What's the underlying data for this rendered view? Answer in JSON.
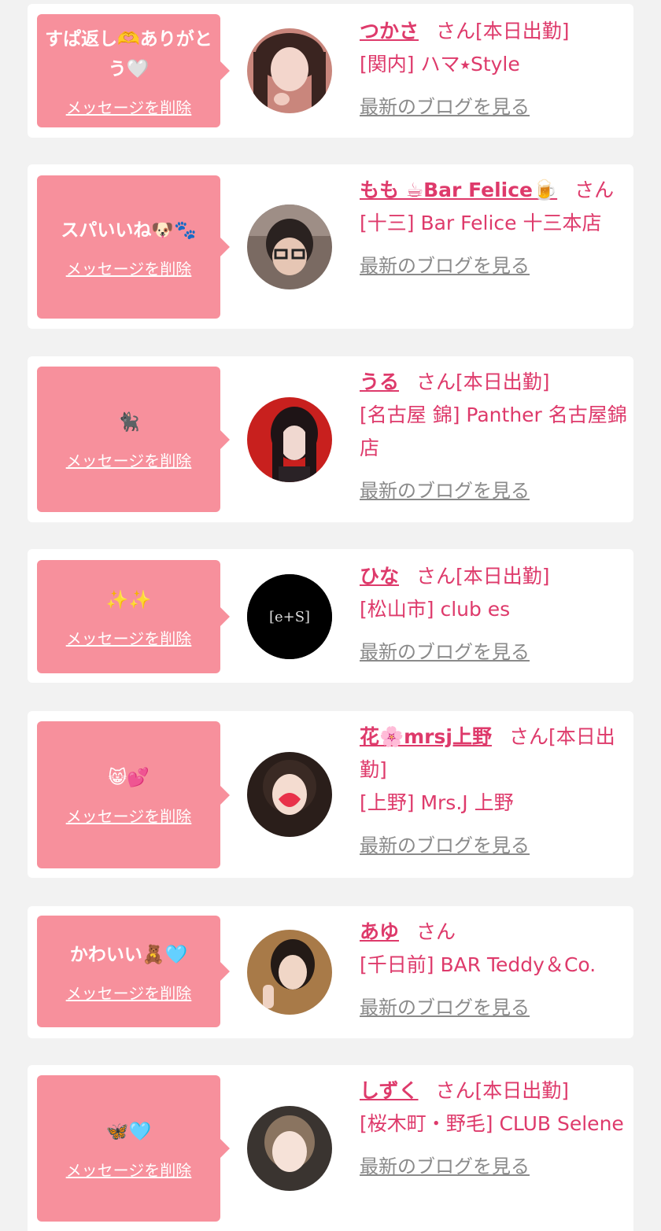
{
  "items": [
    {
      "message": "すぱ返し🫶ありがとう🤍",
      "delete_label": "メッセージを削除",
      "name": "つかさ",
      "san": "さん",
      "status": "[本日出勤]",
      "shop": "[関内] ハマ⭑Style",
      "blog_label": "最新のブログを見る"
    },
    {
      "message": "スパいいね🐶🐾",
      "delete_label": "メッセージを削除",
      "name": "もも ☕Bar Felice🍺",
      "san": "さん",
      "status": "",
      "shop": "[十三] Bar Felice 十三本店",
      "blog_label": "最新のブログを見る"
    },
    {
      "message": "🐈‍⬛",
      "delete_label": "メッセージを削除",
      "name": "うる",
      "san": "さん",
      "status": "[本日出勤]",
      "shop": "[名古屋 錦] Panther 名古屋錦店",
      "blog_label": "最新のブログを見る"
    },
    {
      "message": "✨✨",
      "delete_label": "メッセージを削除",
      "name": "ひな",
      "san": "さん",
      "status": "[本日出勤]",
      "shop": "[松山市] club es",
      "blog_label": "最新のブログを見る",
      "avatar_text": "[e+S]"
    },
    {
      "message": "😸💕",
      "delete_label": "メッセージを削除",
      "name": "花🌸mrsj上野",
      "san": "さん",
      "status": "[本日出勤]",
      "shop": "[上野] Mrs.J 上野",
      "blog_label": "最新のブログを見る"
    },
    {
      "message": "かわいい🧸🩵",
      "delete_label": "メッセージを削除",
      "name": "あゆ",
      "san": "さん",
      "status": "",
      "shop": "[千日前] BAR Teddy＆Co.",
      "blog_label": "最新のブログを見る"
    },
    {
      "message": "🦋🩵",
      "delete_label": "メッセージを削除",
      "name": "しずく",
      "san": "さん",
      "status": "[本日出勤]",
      "shop": "[桜木町・野毛] CLUB Selene",
      "blog_label": "最新のブログを見る"
    }
  ],
  "colors": {
    "accent": "#de3a6b",
    "bubble": "#f7909c",
    "background": "#f2f2f2",
    "card": "#ffffff",
    "link_gray": "#8a8a8a"
  }
}
